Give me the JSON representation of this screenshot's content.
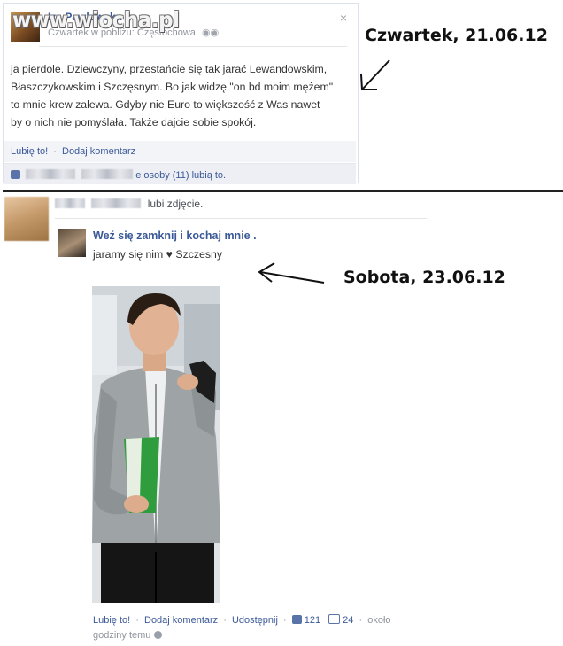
{
  "watermark": "www.wiocha.pl",
  "post1": {
    "author": "Iza Pawlowska",
    "meta": "Czwartek w pobliżu: Częstochowa",
    "close": "×",
    "body": "ja pierdole. Dziewczyny, przestańcie się tak jarać Lewandowskim,\nBłaszczykowskim i Szczęsnym. Bo jak widzę \"on bd moim mężem\"\nto mnie krew zalewa. Gdyby nie Euro to większość z Was nawet\nby o nich nie pomyślała. Także dajcie sobie spokój.",
    "like_action": "Lubię to!",
    "comment_action": "Dodaj komentarz",
    "likes_text": "e osoby (11) lubią to."
  },
  "annotations": {
    "first": "Czwartek, 21.06.12",
    "second": "Sobota, 23.06.12"
  },
  "post2": {
    "liker_action": "lubi zdjęcie.",
    "page_name": "Weź się zamknij i kochaj mnie .",
    "caption": "jaramy się nim ♥ Szczesny",
    "like_action": "Lubię to!",
    "comment_action": "Dodaj komentarz",
    "share_action": "Udostępnij",
    "likes_count": "121",
    "comments_count": "24",
    "time": "około godziny temu"
  },
  "colors": {
    "link": "#3b5998",
    "action_bar": "#f2f4f8"
  },
  "icons": [
    "close-icon",
    "friends-icon",
    "thumbs-up-icon",
    "comment-icon",
    "globe-icon",
    "arrow-icon"
  ]
}
